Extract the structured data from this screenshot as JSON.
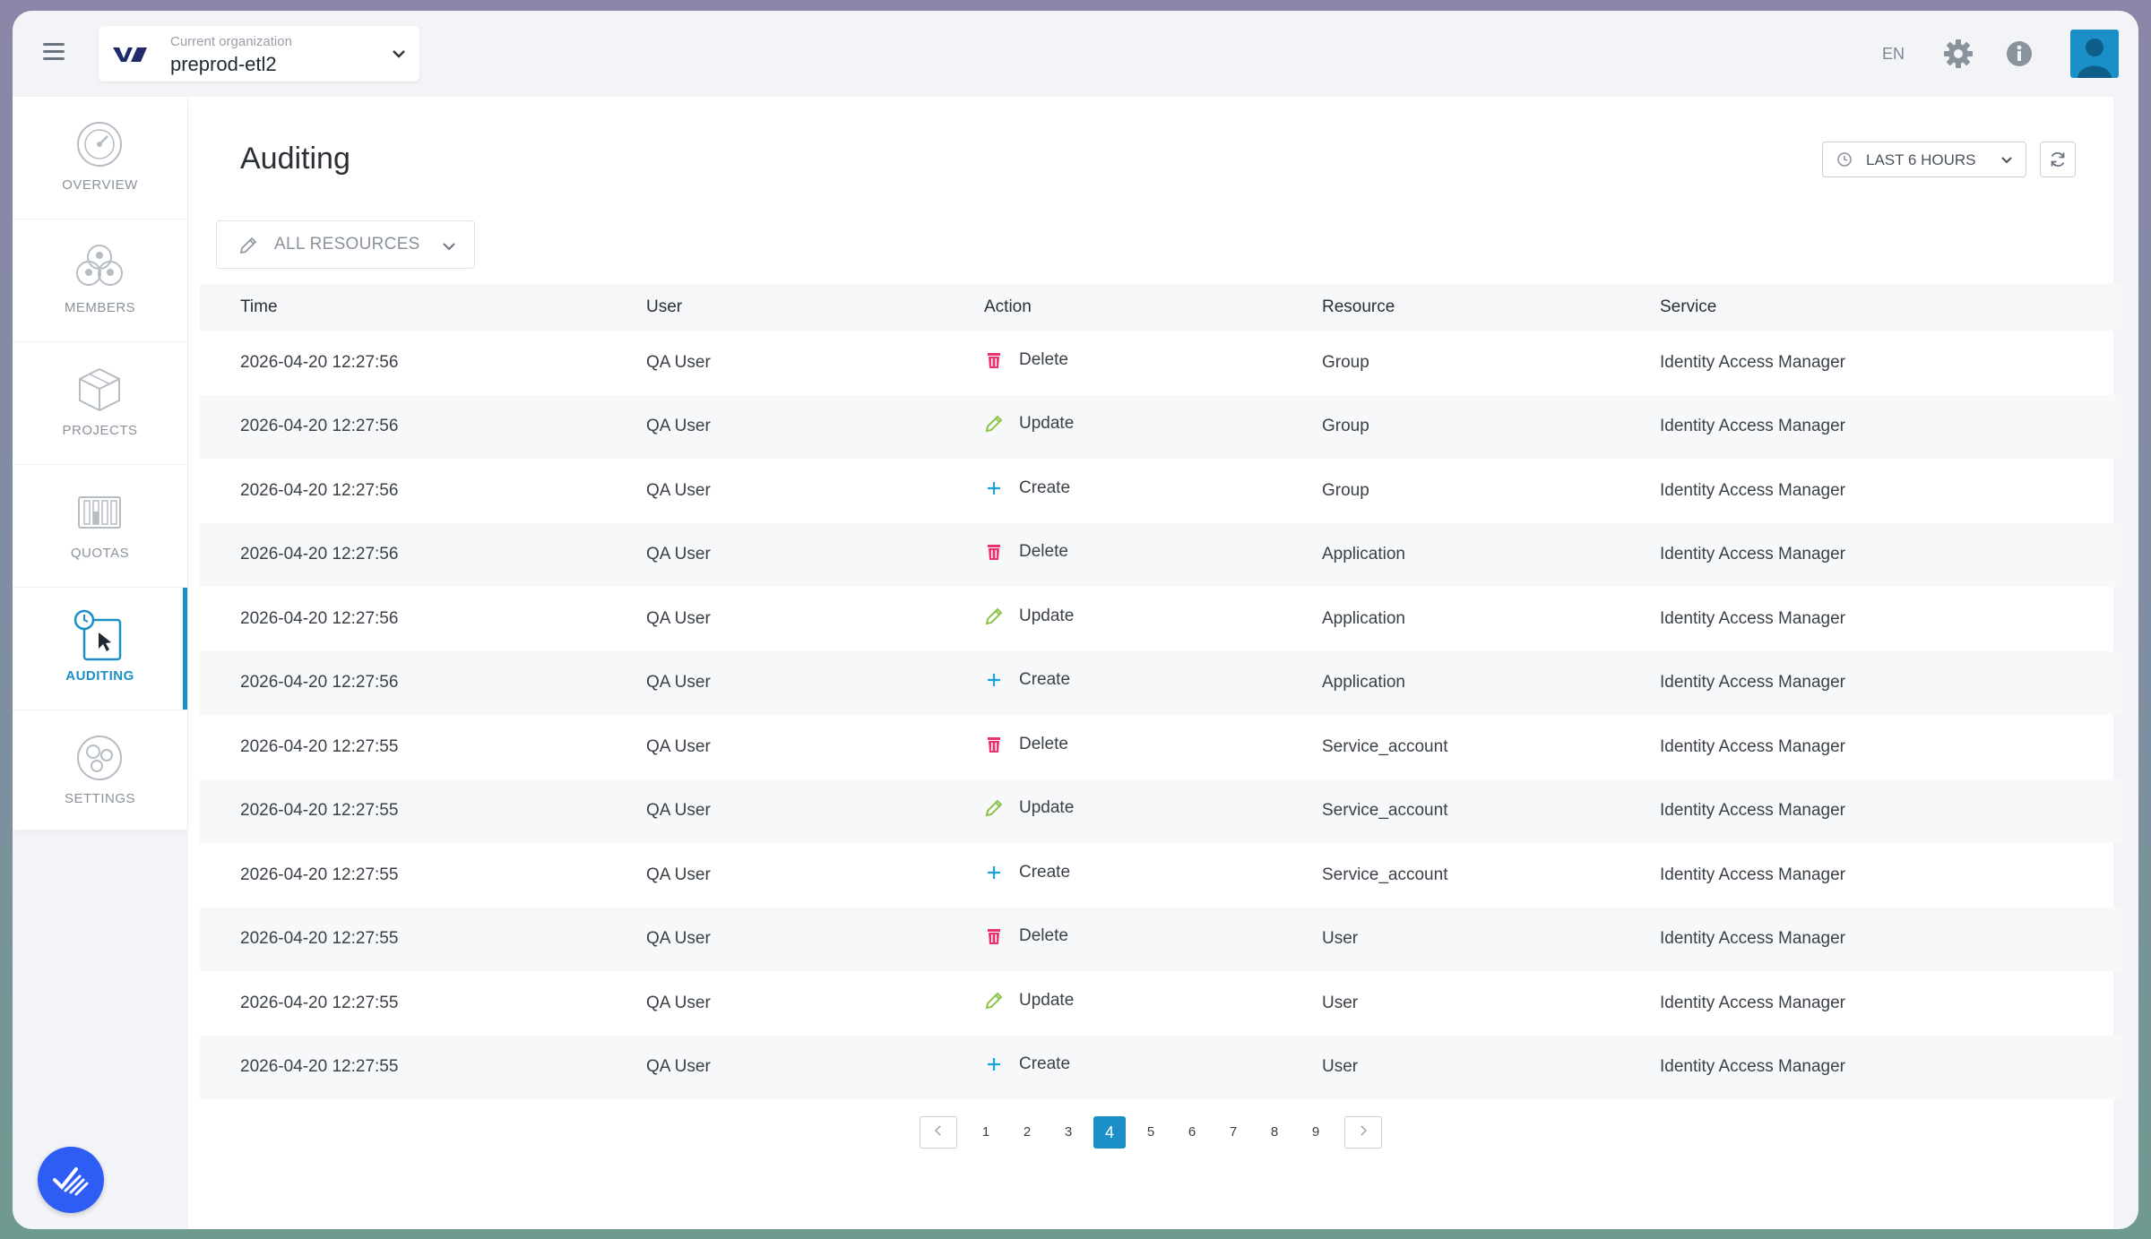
{
  "header": {
    "org_caption": "Current organization",
    "org_name": "preprod-etl2",
    "language": "EN"
  },
  "sidebar": {
    "items": [
      {
        "label": "OVERVIEW",
        "icon": "overview-icon",
        "active": false
      },
      {
        "label": "MEMBERS",
        "icon": "members-icon",
        "active": false
      },
      {
        "label": "PROJECTS",
        "icon": "projects-icon",
        "active": false
      },
      {
        "label": "QUOTAS",
        "icon": "quotas-icon",
        "active": false
      },
      {
        "label": "AUDITING",
        "icon": "auditing-icon",
        "active": true
      },
      {
        "label": "SETTINGS",
        "icon": "settings-icon",
        "active": false
      }
    ]
  },
  "main": {
    "title": "Auditing",
    "time_range": "LAST 6 HOURS",
    "resource_filter": "ALL RESOURCES",
    "columns": [
      "Time",
      "User",
      "Action",
      "Resource",
      "Service"
    ],
    "rows": [
      {
        "time": "2026-04-20 12:27:56",
        "user": "QA User",
        "action": "Delete",
        "resource": "Group",
        "service": "Identity Access Manager"
      },
      {
        "time": "2026-04-20 12:27:56",
        "user": "QA User",
        "action": "Update",
        "resource": "Group",
        "service": "Identity Access Manager"
      },
      {
        "time": "2026-04-20 12:27:56",
        "user": "QA User",
        "action": "Create",
        "resource": "Group",
        "service": "Identity Access Manager"
      },
      {
        "time": "2026-04-20 12:27:56",
        "user": "QA User",
        "action": "Delete",
        "resource": "Application",
        "service": "Identity Access Manager"
      },
      {
        "time": "2026-04-20 12:27:56",
        "user": "QA User",
        "action": "Update",
        "resource": "Application",
        "service": "Identity Access Manager"
      },
      {
        "time": "2026-04-20 12:27:56",
        "user": "QA User",
        "action": "Create",
        "resource": "Application",
        "service": "Identity Access Manager"
      },
      {
        "time": "2026-04-20 12:27:55",
        "user": "QA User",
        "action": "Delete",
        "resource": "Service_account",
        "service": "Identity Access Manager"
      },
      {
        "time": "2026-04-20 12:27:55",
        "user": "QA User",
        "action": "Update",
        "resource": "Service_account",
        "service": "Identity Access Manager"
      },
      {
        "time": "2026-04-20 12:27:55",
        "user": "QA User",
        "action": "Create",
        "resource": "Service_account",
        "service": "Identity Access Manager"
      },
      {
        "time": "2026-04-20 12:27:55",
        "user": "QA User",
        "action": "Delete",
        "resource": "User",
        "service": "Identity Access Manager"
      },
      {
        "time": "2026-04-20 12:27:55",
        "user": "QA User",
        "action": "Update",
        "resource": "User",
        "service": "Identity Access Manager"
      },
      {
        "time": "2026-04-20 12:27:55",
        "user": "QA User",
        "action": "Create",
        "resource": "User",
        "service": "Identity Access Manager"
      }
    ],
    "pagination": {
      "pages": [
        "1",
        "2",
        "3",
        "4",
        "5",
        "6",
        "7",
        "8",
        "9"
      ],
      "current": "4"
    }
  },
  "colors": {
    "accent": "#1a8fc8",
    "delete": "#e8336d",
    "update": "#8bc34a",
    "create": "#1aa3d9",
    "fab": "#2d5df5"
  }
}
